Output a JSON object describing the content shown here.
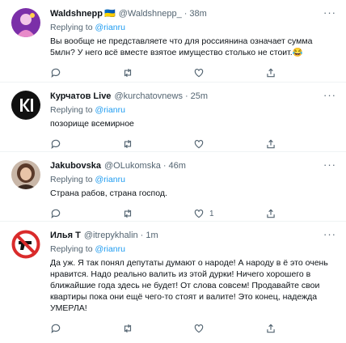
{
  "replying_label": "Replying to",
  "replying_handle": "@rianru",
  "tweets": [
    {
      "name": "Waldshnepp",
      "badge": "🇺🇦",
      "handle": "@Waldshnepp_",
      "time": "38m",
      "text": "Вы вообще не представляете что для россиянина означает сумма 5млн? У него всё вместе взятое имущество столько не стоит.😂",
      "likes": "",
      "avatar_icon": "purple-figure-avatar"
    },
    {
      "name": "Курчатов Live",
      "badge": "",
      "handle": "@kurchatovnews",
      "time": "25m",
      "text": "позорище всемирное",
      "likes": "",
      "avatar_icon": "ki-logo-avatar"
    },
    {
      "name": "Jakubovska",
      "badge": "",
      "handle": "@OLukomska",
      "time": "46m",
      "text": "Страна рабов, страна господ.",
      "likes": "1",
      "avatar_icon": "woman-photo-avatar"
    },
    {
      "name": "Илья Т",
      "badge": "",
      "handle": "@itrepykhalin",
      "time": "1m",
      "text": "Да уж. Я так понял депутаты думают о народе! А народу в ё это очень нравится. Надо реально валить из этой дурки! Ничего хорошего в ближайшие года здесь не будет! От слова совсем! Продавайте свои квартиры пока они ещё чего-то стоят и валите! Это конец, надежда УМЕРЛА!",
      "likes": "",
      "avatar_icon": "no-pistol-sign-avatar"
    }
  ],
  "more_glyph": "···",
  "colors": {
    "link": "#1d9bf0",
    "muted": "#536471",
    "text": "#0f1419"
  }
}
